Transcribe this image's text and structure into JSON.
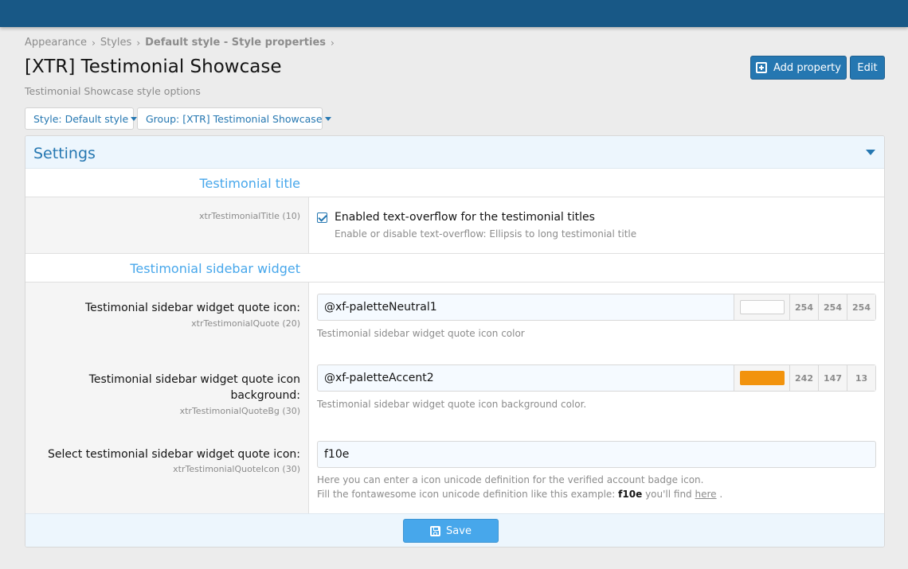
{
  "breadcrumb": {
    "items": [
      "Appearance",
      "Styles"
    ],
    "current": "Default style - Style properties"
  },
  "header": {
    "title": "[XTR] Testimonial Showcase",
    "description": "Testimonial Showcase style options",
    "add_property_label": "Add property",
    "edit_label": "Edit"
  },
  "filters": {
    "style_label": "Style: Default style",
    "group_label": "Group: [XTR] Testimonial Showcase"
  },
  "panel": {
    "title": "Settings",
    "sections": [
      {
        "heading": "Testimonial title",
        "property_id": "xtrTestimonialTitle (10)",
        "checkbox_label": "Enabled text-overflow for the testimonial titles",
        "checkbox_checked": true,
        "hint": "Enable or disable text-overflow: Ellipsis to long testimonial title"
      },
      {
        "heading": "Testimonial sidebar widget",
        "fields": [
          {
            "label": "Testimonial sidebar widget quote icon:",
            "property_id": "xtrTestimonialQuote (20)",
            "value": "@xf-paletteNeutral1",
            "swatch_color": "#fefefe",
            "rgb": [
              "254",
              "254",
              "254"
            ],
            "hint": "Testimonial sidebar widget quote icon color"
          },
          {
            "label_line1": "Testimonial sidebar widget quote icon",
            "label_line2": "background:",
            "property_id": "xtrTestimonialQuoteBg (30)",
            "value": "@xf-paletteAccent2",
            "swatch_color": "#f2930d",
            "rgb": [
              "242",
              "147",
              "13"
            ],
            "hint": "Testimonial sidebar widget quote icon background color."
          },
          {
            "label": "Select testimonial sidebar widget quote icon:",
            "property_id": "xtrTestimonialQuoteIcon (30)",
            "value": "f10e",
            "hint_line1": "Here you can enter a icon unicode definition for the verified account badge icon.",
            "hint_line2_prefix": "Fill the fontawesome icon unicode definition like this example:",
            "hint_line2_code": "f10e",
            "hint_line2_mid": "you'll find",
            "hint_line2_link": "here",
            "hint_line2_suffix": "."
          }
        ]
      }
    ],
    "save_label": "Save"
  },
  "colors": {
    "topbar": "#185886",
    "accent": "#2577b1",
    "section_heading": "#47a7eb"
  }
}
